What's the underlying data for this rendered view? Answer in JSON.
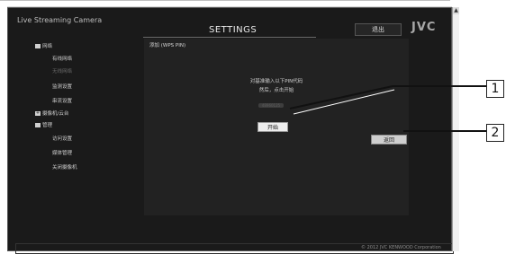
{
  "window": {
    "app_title": "Live Streaming Camera",
    "page_title": "SETTINGS",
    "logout_label": "退出",
    "logo": "JVC"
  },
  "sidebar": {
    "items": [
      {
        "label": "网络",
        "marker": "",
        "state": "expanded"
      },
      {
        "label": "有线网络",
        "state": "normal"
      },
      {
        "label": "无线网络",
        "state": "disabled"
      },
      {
        "label": "监测设置",
        "state": "normal"
      },
      {
        "label": "串流设置",
        "state": "normal"
      },
      {
        "label": "摄像机/云台",
        "marker": "+",
        "state": "collapsed"
      },
      {
        "label": "管理",
        "marker": "",
        "state": "expanded"
      },
      {
        "label": "访问设置",
        "state": "normal"
      },
      {
        "label": "媒体管理",
        "state": "normal"
      },
      {
        "label": "关闭摄像机",
        "state": "normal"
      }
    ]
  },
  "main": {
    "section_title": "添加 (WPS PIN)",
    "instruction_line1": "对基准输入以下PIN代码",
    "instruction_line2": "然后，点击开始",
    "pin_code": "48960125",
    "start_label": "开始",
    "back_label": "返回"
  },
  "footer": {
    "copyright": "© 2012 JVC KENWOOD Corporation"
  },
  "callouts": [
    "1",
    "2"
  ]
}
